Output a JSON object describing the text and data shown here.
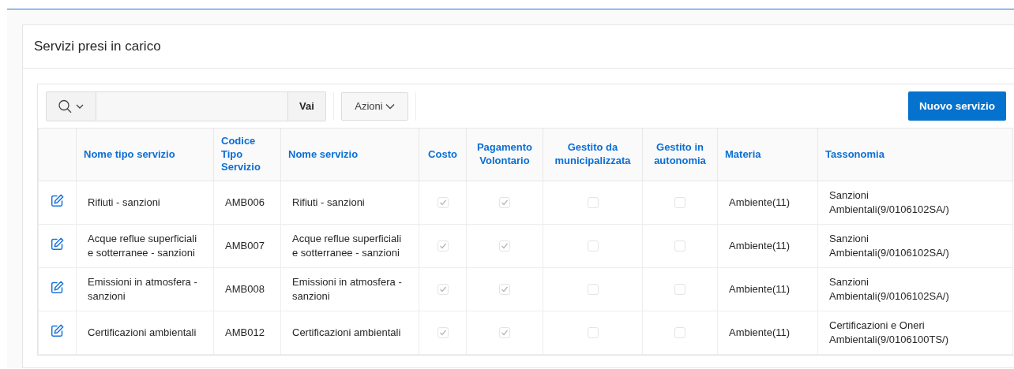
{
  "region": {
    "title": "Servizi presi in carico"
  },
  "toolbar": {
    "go_button": "Vai",
    "actions_menu": "Azioni",
    "new_button": "Nuovo servizio"
  },
  "table": {
    "columns": [
      {
        "label": "Nome tipo servizio",
        "kind": "text"
      },
      {
        "label": "Codice Tipo Servizio",
        "kind": "text"
      },
      {
        "label": "Nome servizio",
        "kind": "text"
      },
      {
        "label": "Costo",
        "kind": "check"
      },
      {
        "label": "Pagamento Volontario",
        "kind": "check"
      },
      {
        "label": "Gestito da municipalizzata",
        "kind": "check"
      },
      {
        "label": "Gestito in autonomia",
        "kind": "check"
      },
      {
        "label": "Materia",
        "kind": "text"
      },
      {
        "label": "Tassonomia",
        "kind": "text"
      }
    ],
    "rows": [
      {
        "cells": [
          "Rifiuti - sanzioni",
          "AMB006",
          "Rifiuti - sanzioni",
          true,
          true,
          false,
          false,
          "Ambiente(11)",
          "Sanzioni Ambientali(9/0106102SA/)"
        ]
      },
      {
        "cells": [
          "Acque reflue superficiali e sotterranee - sanzioni",
          "AMB007",
          "Acque reflue superficiali e sotterranee - sanzioni",
          true,
          true,
          false,
          false,
          "Ambiente(11)",
          "Sanzioni Ambientali(9/0106102SA/)"
        ]
      },
      {
        "cells": [
          "Emissioni in atmosfera - sanzioni",
          "AMB008",
          "Emissioni in atmosfera - sanzioni",
          true,
          true,
          false,
          false,
          "Ambiente(11)",
          "Sanzioni Ambientali(9/0106102SA/)"
        ]
      },
      {
        "cells": [
          "Certificazioni ambientali",
          "AMB012",
          "Certificazioni ambientali",
          true,
          true,
          false,
          false,
          "Ambiente(11)",
          "Certificazioni e Oneri Ambientali(9/0106100TS/)"
        ]
      }
    ]
  }
}
